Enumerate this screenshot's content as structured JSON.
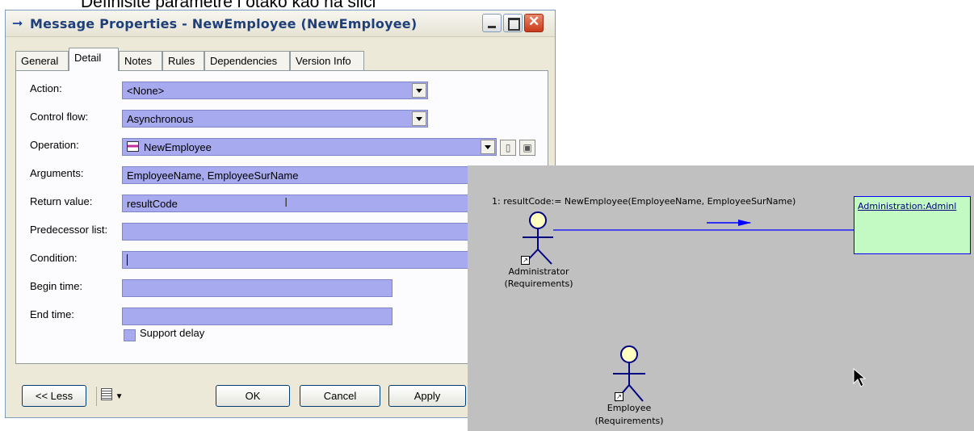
{
  "slide_title": "Definišite parametre i otako kao na slici",
  "window": {
    "title": "Message Properties - NewEmployee (NewEmployee)",
    "title_icon": "arrow-right-icon"
  },
  "tabs": [
    "General",
    "Detail",
    "Notes",
    "Rules",
    "Dependencies",
    "Version Info"
  ],
  "active_tab": "Detail",
  "form": {
    "action": {
      "label": "Action:",
      "value": "<None>"
    },
    "control_flow": {
      "label": "Control flow:",
      "value": "Asynchronous"
    },
    "operation": {
      "label": "Operation:",
      "value": "NewEmployee"
    },
    "arguments": {
      "label": "Arguments:",
      "value": "EmployeeName, EmployeeSurName"
    },
    "return_value": {
      "label": "Return value:",
      "value": "resultCode"
    },
    "predecessor_list": {
      "label": "Predecessor list:",
      "value": ""
    },
    "condition": {
      "label": "Condition:",
      "value": ""
    },
    "begin_time": {
      "label": "Begin time:",
      "value": ""
    },
    "end_time": {
      "label": "End time:",
      "value": ""
    },
    "support_delay": {
      "label": "Support delay",
      "checked": false
    }
  },
  "buttons": {
    "less": "<< Less",
    "ok": "OK",
    "cancel": "Cancel",
    "apply": "Apply"
  },
  "diagram": {
    "message_label": "1: resultCode:= NewEmployee(EmployeeName, EmployeeSurName)",
    "object_name": "Administration:Adminl",
    "actor1": {
      "name": "Administrator",
      "package": "(Requirements)"
    },
    "actor2": {
      "name": "Employee",
      "package": "(Requirements)"
    },
    "colors": {
      "canvas": "#c0c0c0",
      "object_fill": "#c3fac3",
      "link": "#0000ff",
      "actor_head": "#ffffc0",
      "field_fill": "#a8aaf0"
    }
  }
}
